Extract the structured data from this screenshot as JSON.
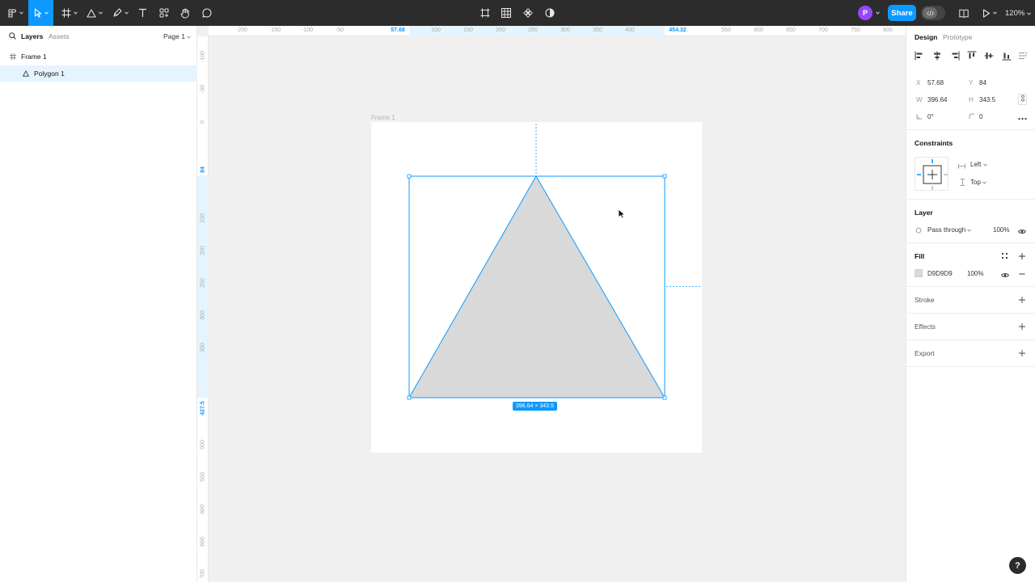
{
  "toolbar": {
    "tools": [
      "main-menu",
      "move",
      "frame",
      "shape",
      "pen",
      "text",
      "resources",
      "hand",
      "comment"
    ],
    "center_tools": [
      "crop",
      "grid",
      "component",
      "contrast"
    ],
    "avatar_initial": "P",
    "share_label": "Share",
    "zoom_label": "120%"
  },
  "left_panel": {
    "tabs": [
      "Layers",
      "Assets"
    ],
    "page_label": "Page 1",
    "layers": [
      {
        "name": "Frame 1",
        "icon": "frame-icon",
        "selected": false
      },
      {
        "name": "Polygon 1",
        "icon": "triangle-icon",
        "selected": true
      }
    ]
  },
  "rulers": {
    "top_ticks": [
      "-200",
      "-150",
      "-100",
      "-50",
      "57.68",
      "100",
      "150",
      "200",
      "250",
      "300",
      "350",
      "400",
      "454.32",
      "550",
      "600",
      "650",
      "700",
      "750",
      "800"
    ],
    "top_highlight": [
      "57.68",
      "454.32"
    ],
    "left_ticks": [
      "-100",
      "-50",
      "0",
      "84",
      "150",
      "200",
      "250",
      "300",
      "350",
      "427.5",
      "500",
      "550",
      "600",
      "650",
      "700"
    ],
    "left_highlight": [
      "84",
      "427.5"
    ]
  },
  "canvas": {
    "frame_label": "Frame 1",
    "dimension_badge": "396.64 × 343.5",
    "polygon_fill": "#D9D9D9",
    "selection_color": "#0D99FF"
  },
  "right_panel": {
    "tabs": [
      "Design",
      "Prototype"
    ],
    "position": {
      "x_label": "X",
      "x_value": "57.68",
      "y_label": "Y",
      "y_value": "84",
      "w_label": "W",
      "w_value": "396.64",
      "h_label": "H",
      "h_value": "343.5",
      "rotation_value": "0°",
      "corner_radius_value": "0"
    },
    "constraints": {
      "title": "Constraints",
      "horizontal": "Left",
      "vertical": "Top"
    },
    "layer": {
      "title": "Layer",
      "blend_mode": "Pass through",
      "opacity": "100%"
    },
    "fill": {
      "title": "Fill",
      "color_hex": "D9D9D9",
      "opacity": "100%"
    },
    "stroke_title": "Stroke",
    "effects_title": "Effects",
    "export_title": "Export"
  },
  "help_label": "?"
}
